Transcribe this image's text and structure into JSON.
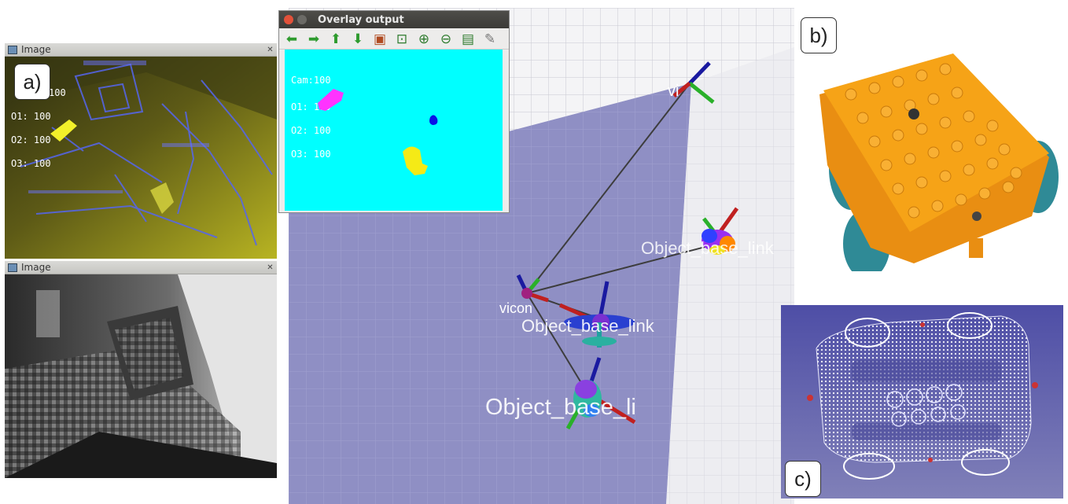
{
  "panel_labels": {
    "a": "a)",
    "b": "b)",
    "c": "c)"
  },
  "image_window_top": {
    "title": "Image",
    "overlay_lines": [
      "100",
      "O1: 100",
      "O2: 100",
      "O3: 100"
    ]
  },
  "image_window_bottom": {
    "title": "Image"
  },
  "overlay_window": {
    "title": "Overlay output",
    "toolbar": [
      {
        "name": "pan-left-icon",
        "glyph": "⬅"
      },
      {
        "name": "pan-right-icon",
        "glyph": "➡"
      },
      {
        "name": "pan-up-icon",
        "glyph": "⬆"
      },
      {
        "name": "pan-down-icon",
        "glyph": "⬇"
      },
      {
        "name": "image-icon",
        "glyph": "▣"
      },
      {
        "name": "zoom-fit-icon",
        "glyph": "⊡"
      },
      {
        "name": "zoom-in-icon",
        "glyph": "⊕"
      },
      {
        "name": "zoom-out-icon",
        "glyph": "⊖"
      },
      {
        "name": "save-icon",
        "glyph": "▤"
      },
      {
        "name": "brush-icon",
        "glyph": "✎"
      }
    ],
    "lines": [
      "Cam:100",
      "O1: 100",
      "O2: 100",
      "O3: 100"
    ]
  },
  "viz_labels": {
    "vicon": "vicon",
    "object_right": "Object_base_link",
    "object_center": "Object_base_link",
    "object_bottom": "Object_base_li",
    "top_right": "vi"
  },
  "colors": {
    "cyan": "#00ffff",
    "magenta": "#ff33ff",
    "blue": "#0a14e6",
    "yellow": "#f5ea16",
    "frustum": "#7474b6",
    "lego_orange": "#f6a317",
    "wheel_teal": "#2f8a96"
  }
}
